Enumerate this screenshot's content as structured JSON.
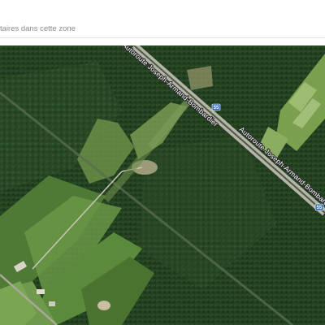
{
  "search": {
    "partial_text": "taires dans cette zone"
  },
  "map": {
    "road_label_upper": "Autoroute Joseph-Armand-Bombardier",
    "road_label_lower": "Autoroute Joseph-Armand-Bombardier",
    "route_number_1": "55",
    "route_number_2": "55",
    "colors": {
      "forest": "#1f3a1c",
      "field": "#5c8a3e",
      "highway": "#a8a89c"
    }
  }
}
